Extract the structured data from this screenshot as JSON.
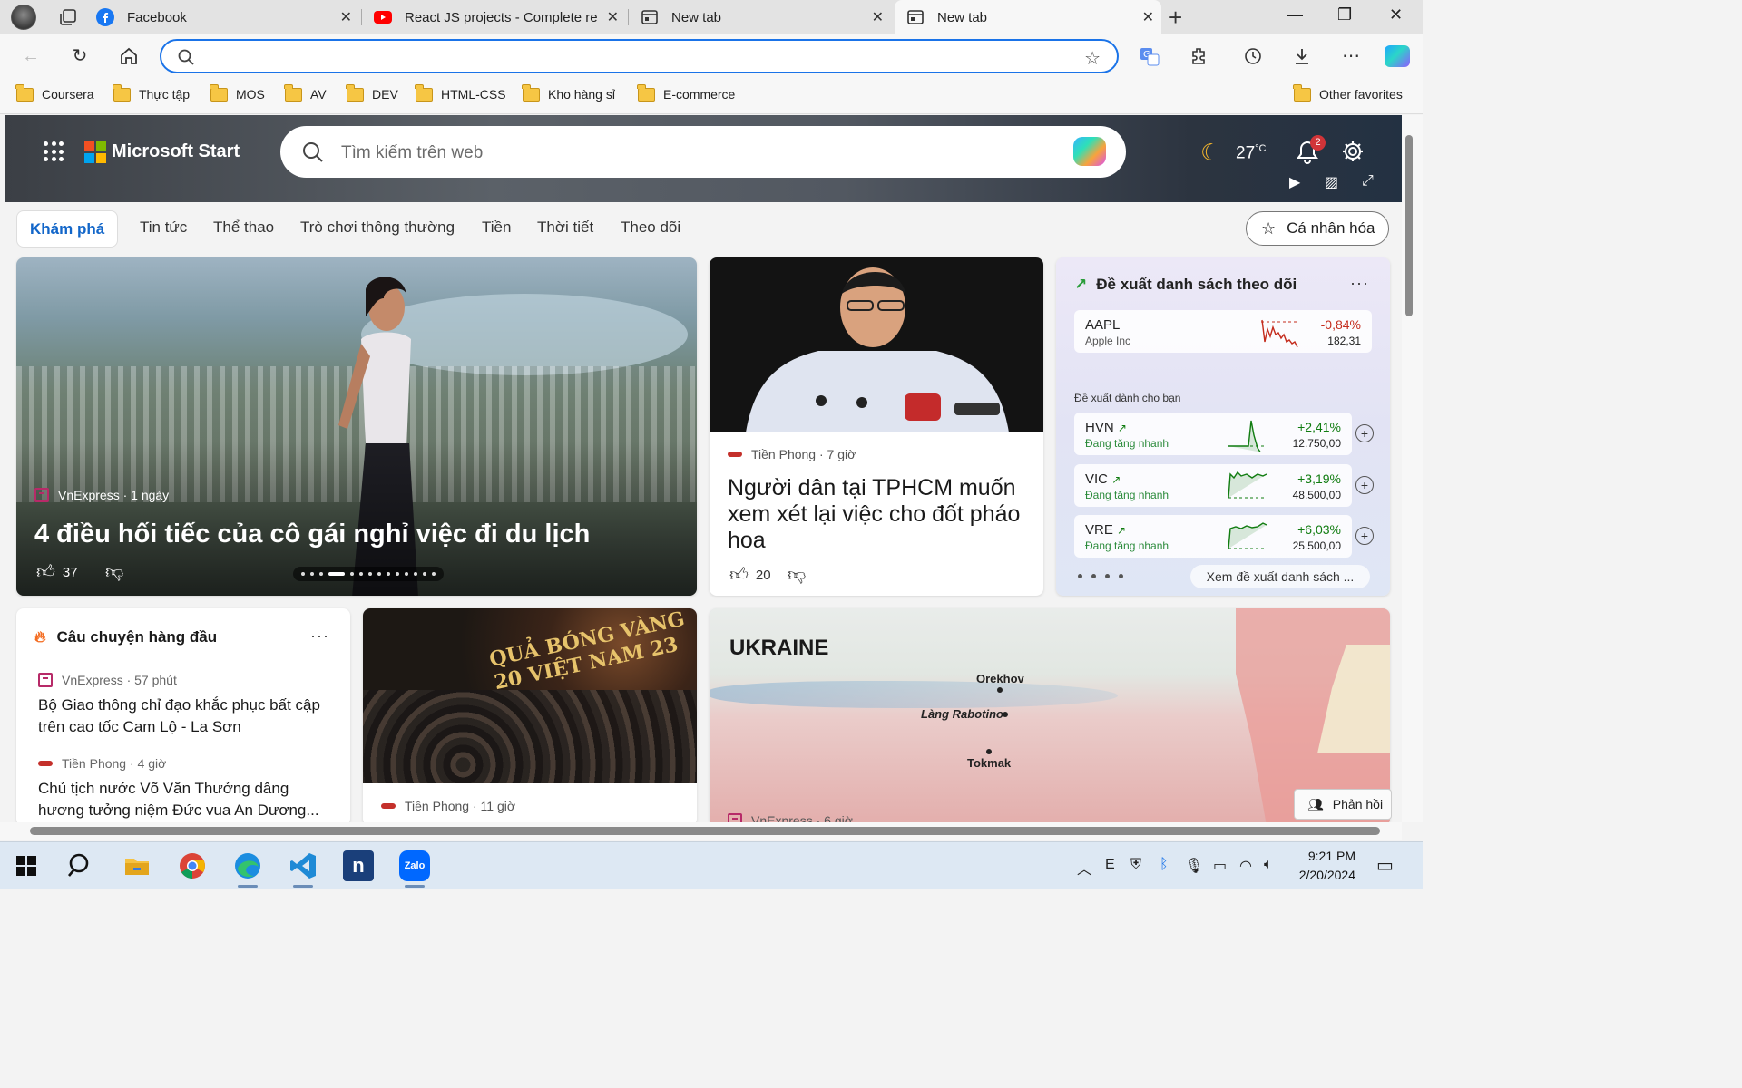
{
  "browser": {
    "tabs": [
      {
        "label": "Facebook",
        "icon": "facebook-icon"
      },
      {
        "label": "React JS projects - Complete resp",
        "icon": "youtube-icon"
      },
      {
        "label": "New tab",
        "icon": "newtab-icon"
      },
      {
        "label": "New tab",
        "icon": "newtab-icon",
        "active": true
      }
    ],
    "address": {
      "value": "",
      "placeholder": ""
    },
    "bookmarks": [
      "Coursera",
      "Thực tập",
      "MOS",
      "AV",
      "DEV",
      "HTML-CSS",
      "Kho hàng sỉ",
      "E-commerce"
    ],
    "other_favorites": "Other favorites"
  },
  "hero": {
    "brand": "Microsoft Start",
    "search_placeholder": "Tìm kiếm trên web",
    "temperature": "27",
    "temp_unit": "°C",
    "notifications": "2"
  },
  "nav": {
    "tabs": [
      "Khám phá",
      "Tin tức",
      "Thể thao",
      "Trò chơi thông thường",
      "Tiền",
      "Thời tiết",
      "Theo dõi"
    ],
    "personalize": "Cá nhân hóa"
  },
  "main_story": {
    "source": "VnExpress",
    "age": "1 ngày",
    "source_line": "VnExpress · 1 ngày",
    "title": "4 điều hối tiếc của cô gái nghỉ việc đi du lịch",
    "likes": "37"
  },
  "story2": {
    "source_line": "Tiền Phong · 7 giờ",
    "title": "Người dân tại TPHCM muốn xem xét lại việc cho đốt pháo hoa",
    "likes": "20"
  },
  "watchlist": {
    "title": "Đề xuất danh sách theo dõi",
    "primary": {
      "ticker": "AAPL",
      "name": "Apple Inc",
      "change": "-0,84%",
      "price": "182,31"
    },
    "suggest_label": "Đề xuất dành cho bạn",
    "suggestions": [
      {
        "ticker": "HVN",
        "status": "Đang tăng nhanh",
        "change": "+2,41%",
        "price": "12.750,00"
      },
      {
        "ticker": "VIC",
        "status": "Đang tăng nhanh",
        "change": "+3,19%",
        "price": "48.500,00"
      },
      {
        "ticker": "VRE",
        "status": "Đang tăng nhanh",
        "change": "+6,03%",
        "price": "25.500,00"
      }
    ],
    "view_all": "Xem đề xuất danh sách ..."
  },
  "top_stories": {
    "title": "Câu chuyện hàng đầu",
    "items": [
      {
        "source_line": "VnExpress · 57 phút",
        "headline": "Bộ Giao thông chỉ đạo khắc phục bất cập trên cao tốc Cam Lộ - La Sơn"
      },
      {
        "source_line": "Tiền Phong · 4 giờ",
        "headline": "Chủ tịch nước Võ Văn Thưởng dâng hương tưởng niệm Đức vua An Dương..."
      }
    ]
  },
  "ball_card": {
    "overlay": "QUẢ BÓNG VÀNG 20 VIỆT NAM 23",
    "source_line": "Tiền Phong · 11 giờ"
  },
  "map_card": {
    "country": "UKRAINE",
    "places": [
      "Orekhov",
      "Làng Rabotino",
      "Tokmak"
    ],
    "source_line": "VnExpress · 6 giờ"
  },
  "feedback": "Phản hồi",
  "taskbar": {
    "time": "9:21 PM",
    "date": "2/20/2024"
  },
  "colors": {
    "accent": "#1266c9",
    "negative": "#c42b1c",
    "positive": "#107c10"
  }
}
